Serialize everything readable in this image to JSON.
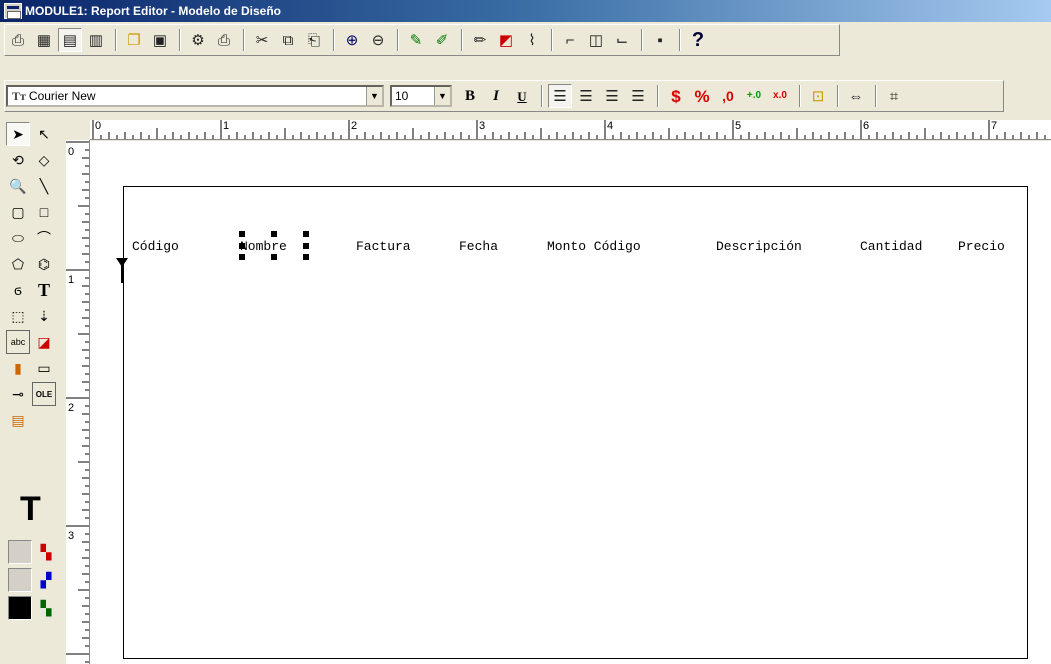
{
  "window": {
    "title": "MODULE1: Report Editor - Modelo de Diseño"
  },
  "toolbar_main": {
    "buttons": [
      {
        "name": "run-report-icon",
        "glyph": "⎙"
      },
      {
        "name": "data-model-icon",
        "glyph": "▦"
      },
      {
        "name": "layout-model-icon",
        "glyph": "▤",
        "pressed": true
      },
      {
        "name": "parameter-form-icon",
        "glyph": "▥"
      },
      {
        "name": "open-icon",
        "glyph": "📂"
      },
      {
        "name": "save-icon",
        "glyph": "▣"
      },
      {
        "name": "run-icon",
        "glyph": "⚙"
      },
      {
        "name": "print-icon",
        "glyph": "⎙"
      },
      {
        "name": "cut-icon",
        "glyph": "✂"
      },
      {
        "name": "copy-icon",
        "glyph": "⧉"
      },
      {
        "name": "paste-icon",
        "glyph": "📋"
      },
      {
        "name": "zoom-in-icon",
        "glyph": "⊕"
      },
      {
        "name": "zoom-out-icon",
        "glyph": "🔍"
      },
      {
        "name": "report-wizard-icon",
        "glyph": "✎"
      },
      {
        "name": "data-wizard-icon",
        "glyph": "✐"
      },
      {
        "name": "edit-icon",
        "glyph": "✏"
      },
      {
        "name": "chart-wizard-icon",
        "glyph": "◩"
      },
      {
        "name": "web-wizard-icon",
        "glyph": "⌇"
      },
      {
        "name": "header-section-icon",
        "glyph": "⌐"
      },
      {
        "name": "main-section-icon",
        "glyph": "◫"
      },
      {
        "name": "trailer-section-icon",
        "glyph": "⌙"
      },
      {
        "name": "confine-icon",
        "glyph": "▪"
      },
      {
        "name": "help-icon",
        "glyph": "?"
      }
    ]
  },
  "toolbar_format": {
    "font_name": "Courier New",
    "font_size": "10",
    "bold_label": "B",
    "italic_label": "I",
    "underline_label": "U",
    "currency_label": "$",
    "percent_label": "%",
    "commas_label": ",0",
    "add_decimal_label": "+.0",
    "remove_decimal_label": "x.0"
  },
  "rulers": {
    "horizontal": [
      "0",
      "1",
      "2",
      "3",
      "4",
      "5",
      "6",
      "7"
    ],
    "vertical": [
      "0",
      "1",
      "2",
      "3"
    ]
  },
  "canvas": {
    "fields": [
      {
        "label": "Código"
      },
      {
        "label": "Nombre"
      },
      {
        "label": "Factura"
      },
      {
        "label": "Fecha"
      },
      {
        "label": "Monto Código"
      },
      {
        "label": "Descripción"
      },
      {
        "label": "Cantidad"
      },
      {
        "label": "Precio"
      }
    ]
  },
  "palette": {
    "fill_color": "#d4d0c8",
    "line_color": "#d4d0c8",
    "text_color": "#000000"
  }
}
